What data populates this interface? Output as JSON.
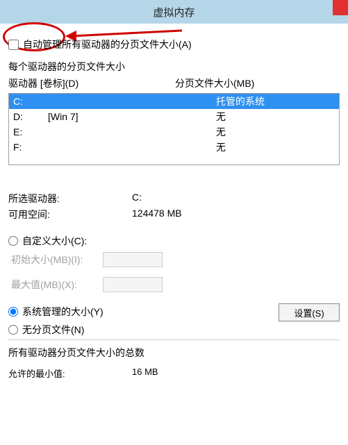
{
  "title": "虚拟内存",
  "auto_manage_label": "自动管理所有驱动器的分页文件大小(A)",
  "each_drive_label": "每个驱动器的分页文件大小",
  "col1": "驱动器 [卷标](D)",
  "col2": "分页文件大小(MB)",
  "drives": [
    {
      "letter": "C:",
      "label": "",
      "size": "托管的系统",
      "selected": true
    },
    {
      "letter": "D:",
      "label": "[Win 7]",
      "size": "无",
      "selected": false
    },
    {
      "letter": "E:",
      "label": "",
      "size": "无",
      "selected": false
    },
    {
      "letter": "F:",
      "label": "",
      "size": "无",
      "selected": false
    }
  ],
  "selected_drive_label": "所选驱动器:",
  "selected_drive_value": "C:",
  "available_label": "可用空间:",
  "available_value": "124478 MB",
  "custom_label": "自定义大小(C):",
  "init_label": "初始大小(MB)(I):",
  "max_label": "最大值(MB)(X):",
  "sysman_label": "系统管理的大小(Y)",
  "nopage_label": "无分页文件(N)",
  "set_btn": "设置(S)",
  "total_label": "所有驱动器分页文件大小的总数",
  "min_label": "允许的最小值:",
  "min_value": "16 MB"
}
